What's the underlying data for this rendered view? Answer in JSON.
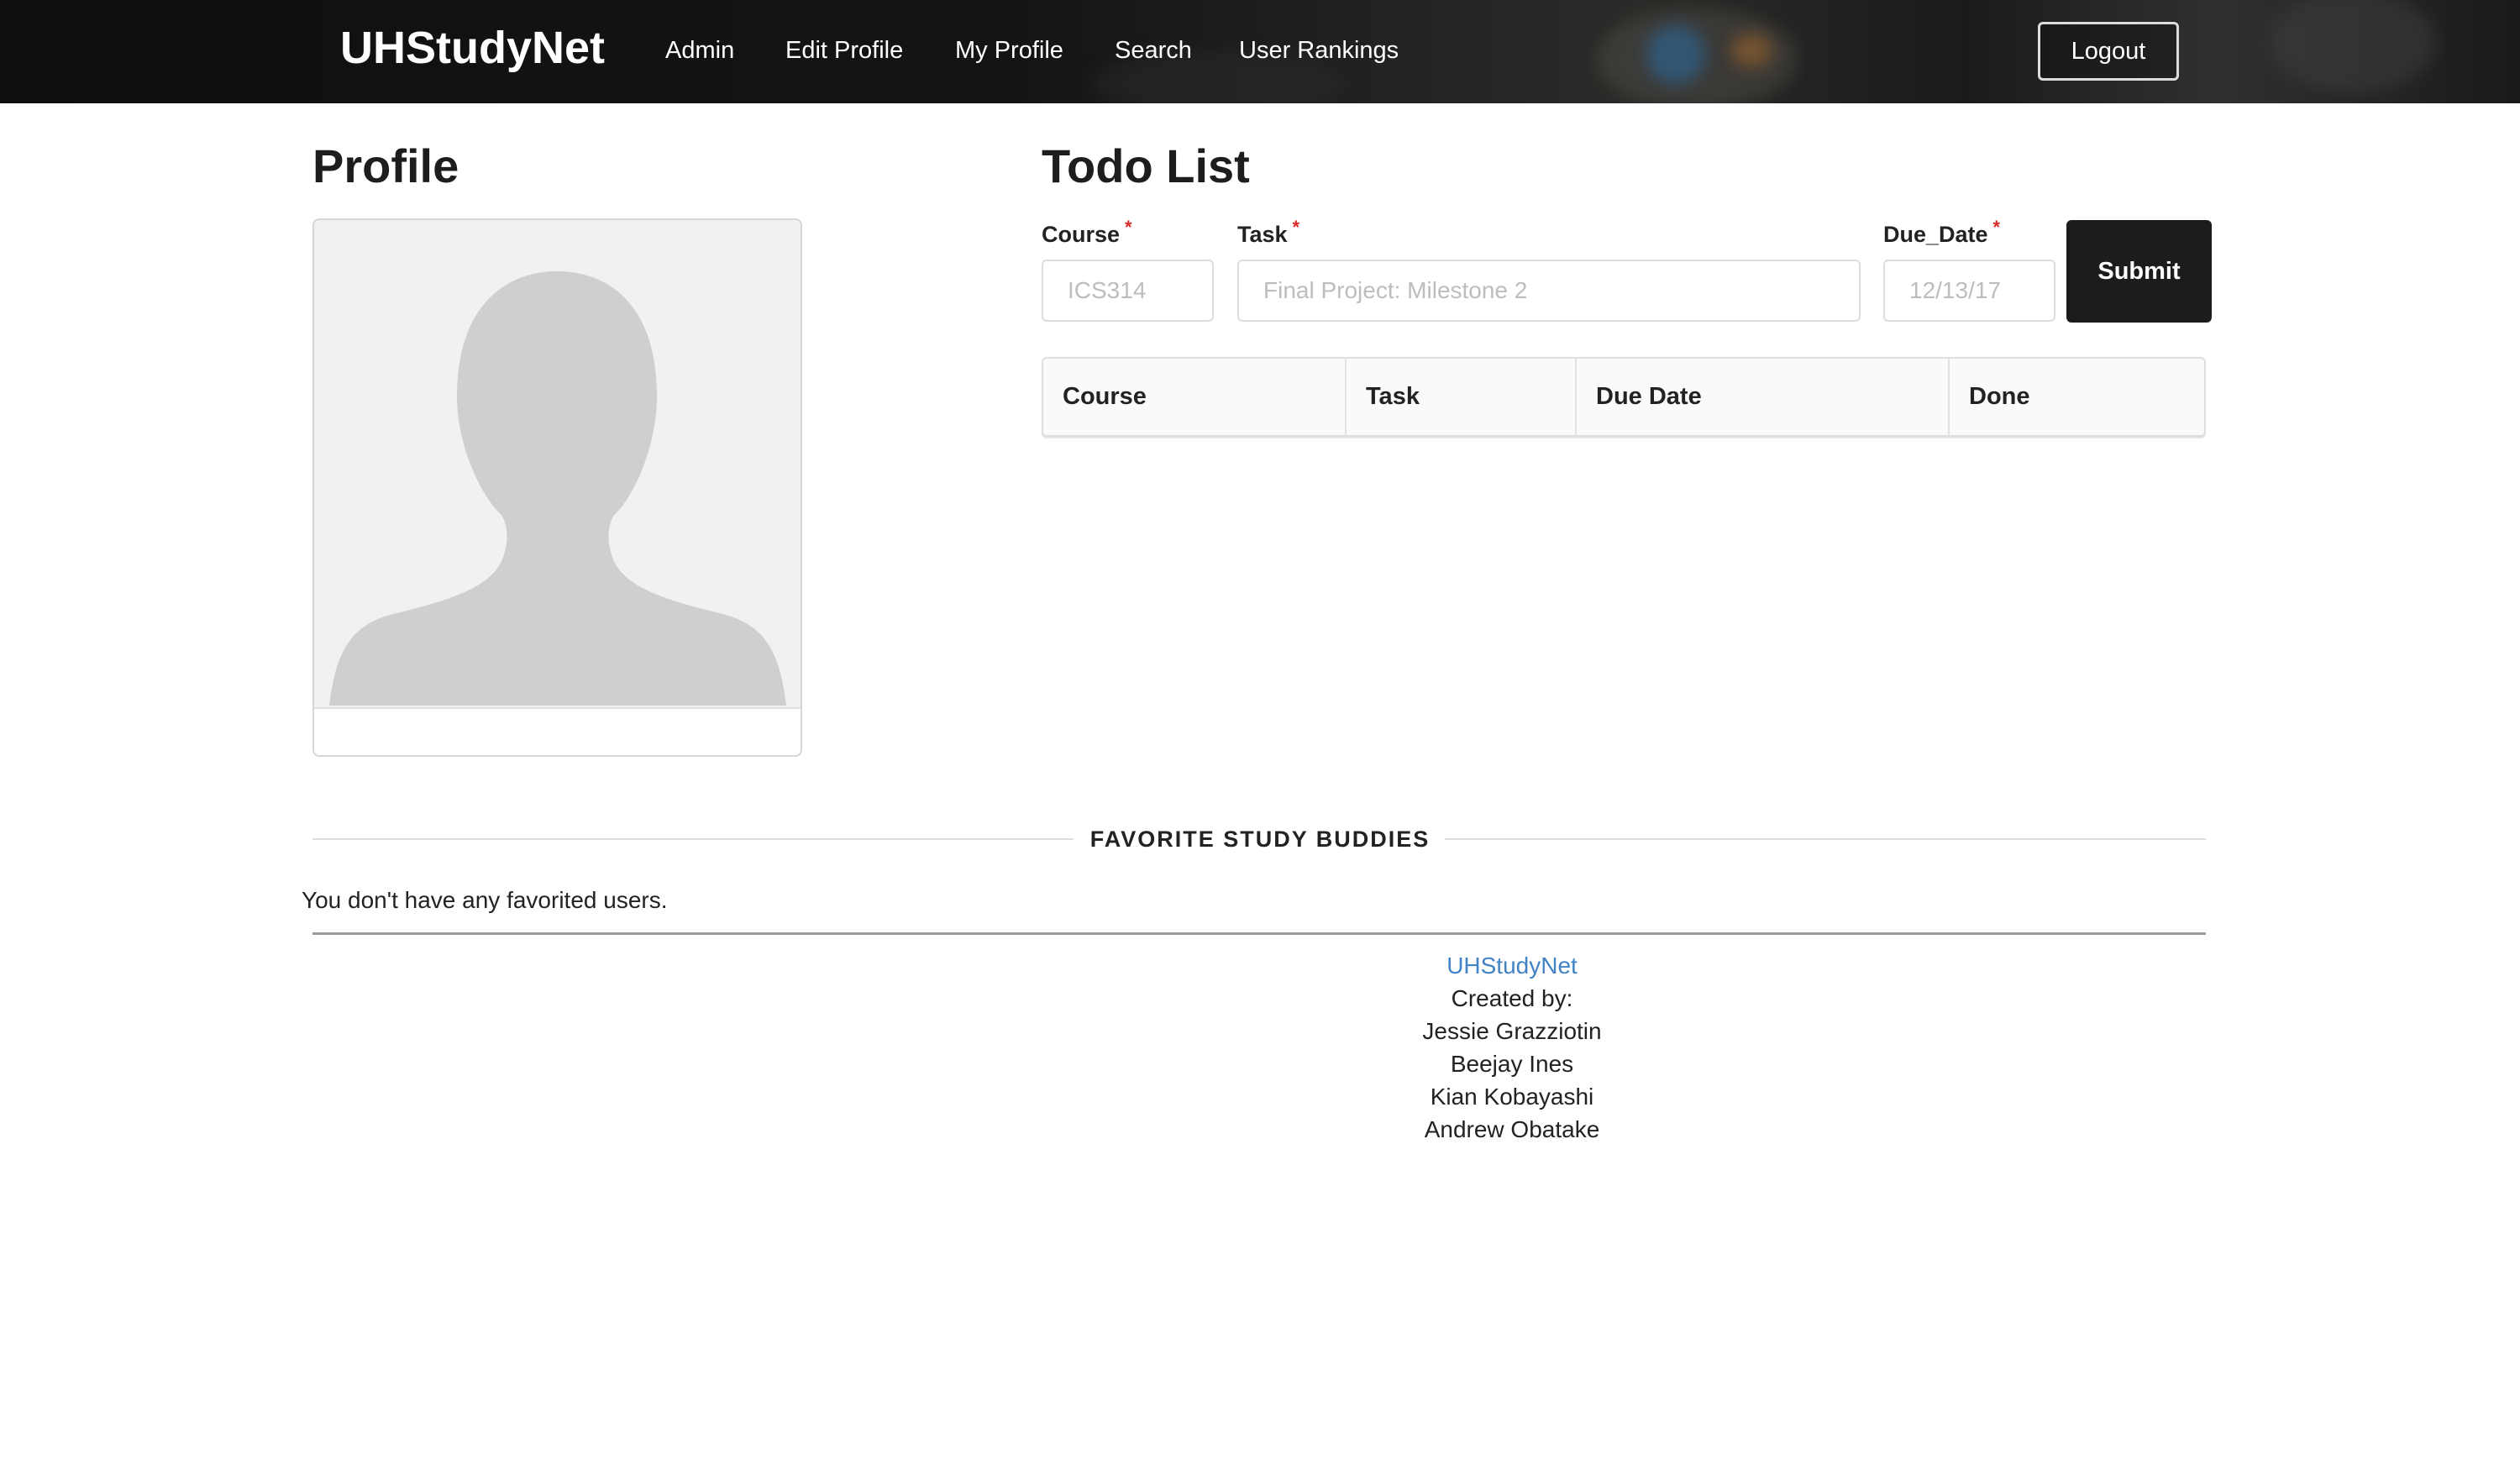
{
  "navbar": {
    "brand": "UHStudyNet",
    "links": [
      "Admin",
      "Edit Profile",
      "My Profile",
      "Search",
      "User Rankings"
    ],
    "logout_label": "Logout"
  },
  "profile": {
    "title": "Profile"
  },
  "todo": {
    "title": "Todo List",
    "form": {
      "course_label": "Course",
      "course_placeholder": "ICS314",
      "task_label": "Task",
      "task_placeholder": "Final Project: Milestone 2",
      "due_label": "Due_Date",
      "due_placeholder": "12/13/17",
      "required_mark": "*",
      "submit_label": "Submit"
    },
    "table": {
      "headers": [
        "Course",
        "Task",
        "Due Date",
        "Done"
      ]
    }
  },
  "favorites": {
    "heading": "FAVORITE STUDY BUDDIES",
    "empty_message": "You don't have any favorited users."
  },
  "footer": {
    "link": "UHStudyNet",
    "created_by": "Created by:",
    "authors": [
      "Jessie Grazziotin",
      "Beejay Ines",
      "Kian Kobayashi",
      "Andrew Obatake"
    ]
  },
  "colors": {
    "accent_link": "#4183c4",
    "required": "#db2828",
    "submit_bg": "#1b1c1d"
  }
}
